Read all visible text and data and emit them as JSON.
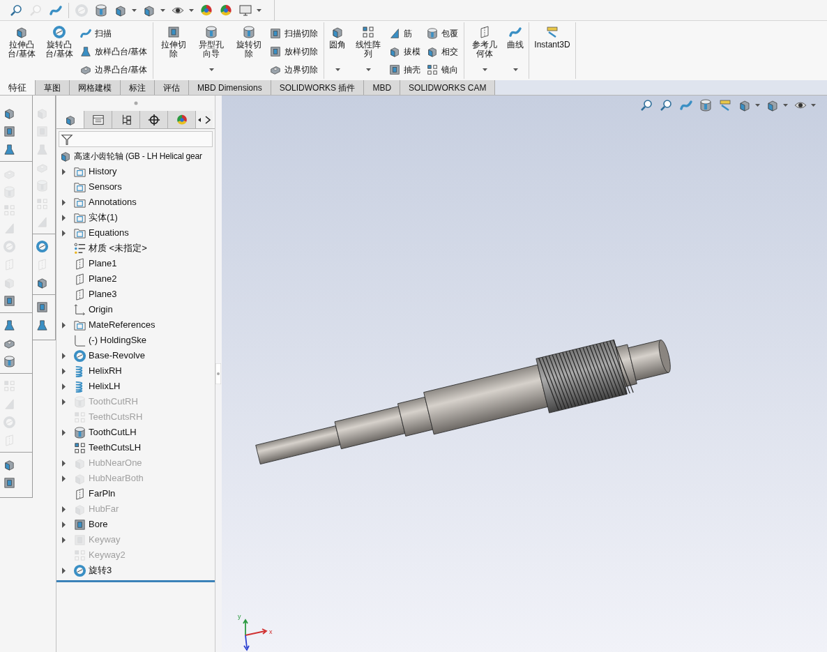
{
  "top_toolbar": [
    {
      "disabled": false,
      "dropdown": false
    },
    {
      "disabled": true,
      "dropdown": false
    },
    {
      "disabled": false,
      "dropdown": false
    },
    {
      "disabled": true,
      "dropdown": false
    },
    {
      "disabled": false,
      "dropdown": false
    },
    {
      "disabled": false,
      "dropdown": true
    },
    {
      "disabled": false,
      "dropdown": true
    },
    {
      "disabled": false,
      "dropdown": true
    },
    {
      "disabled": false,
      "dropdown": false
    },
    {
      "disabled": false,
      "dropdown": false
    },
    {
      "disabled": false,
      "dropdown": true
    }
  ],
  "ribbon": {
    "groups": [
      {
        "items": [
          {
            "kind": "large",
            "label": "拉伸凸台/基体",
            "dropdown": false
          },
          {
            "kind": "large",
            "label": "旋转凸台/基体",
            "dropdown": false
          },
          {
            "kind": "column",
            "labels": [
              "扫描",
              "放样凸台/基体",
              "边界凸台/基体"
            ]
          }
        ]
      },
      {
        "items": [
          {
            "kind": "large",
            "label": "拉伸切除",
            "dropdown": false
          },
          {
            "kind": "large",
            "label": "异型孔向导",
            "dropdown": true
          },
          {
            "kind": "large",
            "label": "旋转切除",
            "dropdown": false
          },
          {
            "kind": "column",
            "labels": [
              "扫描切除",
              "放样切除",
              "边界切除"
            ]
          }
        ]
      },
      {
        "items": [
          {
            "kind": "large",
            "label": "圆角",
            "dropdown": true
          },
          {
            "kind": "large",
            "label": "线性阵列",
            "dropdown": true
          },
          {
            "kind": "column",
            "labels": [
              "筋",
              "拔模",
              "抽壳"
            ]
          },
          {
            "kind": "column",
            "labels": [
              "包覆",
              "相交",
              "镜向"
            ]
          }
        ]
      },
      {
        "items": [
          {
            "kind": "large",
            "label": "参考几何体",
            "dropdown": true
          },
          {
            "kind": "large",
            "label": "曲线",
            "dropdown": true
          }
        ]
      },
      {
        "items": [
          {
            "kind": "large",
            "label": "Instant3D",
            "dropdown": false
          }
        ]
      }
    ]
  },
  "tabs": [
    {
      "label": "特征",
      "selected": true
    },
    {
      "label": "草图",
      "selected": false
    },
    {
      "label": "网格建模",
      "selected": false
    },
    {
      "label": "标注",
      "selected": false
    },
    {
      "label": "评估",
      "selected": false
    },
    {
      "label": "MBD Dimensions",
      "selected": false
    },
    {
      "label": "SOLIDWORKS 插件",
      "selected": false
    },
    {
      "label": "MBD",
      "selected": false
    },
    {
      "label": "SOLIDWORKS CAM",
      "selected": false
    }
  ],
  "left_toolbar_1": [
    {
      "kind": "tool",
      "disabled": false
    },
    {
      "kind": "tool",
      "disabled": false
    },
    {
      "kind": "tool",
      "disabled": false
    },
    {
      "kind": "separator"
    },
    {
      "kind": "tool",
      "disabled": true
    },
    {
      "kind": "tool",
      "disabled": true
    },
    {
      "kind": "tool",
      "disabled": true
    },
    {
      "kind": "tool",
      "disabled": true
    },
    {
      "kind": "tool",
      "disabled": true
    },
    {
      "kind": "tool",
      "disabled": true
    },
    {
      "kind": "tool",
      "disabled": true
    },
    {
      "kind": "tool",
      "disabled": false
    },
    {
      "kind": "separator"
    },
    {
      "kind": "tool",
      "disabled": false
    },
    {
      "kind": "tool",
      "disabled": false
    },
    {
      "kind": "tool",
      "disabled": false
    },
    {
      "kind": "separator"
    },
    {
      "kind": "tool",
      "disabled": true
    },
    {
      "kind": "tool",
      "disabled": true
    },
    {
      "kind": "tool",
      "disabled": true
    },
    {
      "kind": "tool",
      "disabled": true
    },
    {
      "kind": "separator"
    },
    {
      "kind": "tool",
      "disabled": false
    },
    {
      "kind": "tool",
      "disabled": false
    }
  ],
  "left_toolbar_2": [
    {
      "kind": "tool",
      "disabled": true
    },
    {
      "kind": "tool",
      "disabled": true
    },
    {
      "kind": "tool",
      "disabled": true
    },
    {
      "kind": "tool",
      "disabled": true
    },
    {
      "kind": "tool",
      "disabled": true
    },
    {
      "kind": "tool",
      "disabled": true
    },
    {
      "kind": "tool",
      "disabled": true
    },
    {
      "kind": "separator"
    },
    {
      "kind": "tool",
      "disabled": false
    },
    {
      "kind": "tool",
      "disabled": true
    },
    {
      "kind": "tool",
      "disabled": false
    },
    {
      "kind": "separator"
    },
    {
      "kind": "tool",
      "disabled": false
    },
    {
      "kind": "tool",
      "disabled": false
    }
  ],
  "panel_tabs": [
    {
      "selected": true
    },
    {
      "selected": false
    },
    {
      "selected": false
    },
    {
      "selected": false
    },
    {
      "selected": false
    }
  ],
  "tree": {
    "root": "高速小齿轮轴 (GB - LH Helical gear",
    "items": [
      {
        "kind": "folder",
        "label": "History",
        "expandable": true,
        "suppressed": false
      },
      {
        "kind": "folder",
        "label": "Sensors",
        "expandable": false,
        "suppressed": false
      },
      {
        "kind": "folder",
        "label": "Annotations",
        "expandable": true,
        "suppressed": false
      },
      {
        "kind": "folder",
        "label": "实体(1)",
        "expandable": true,
        "suppressed": false
      },
      {
        "kind": "folder",
        "label": "Equations",
        "expandable": true,
        "suppressed": false
      },
      {
        "kind": "material",
        "label": "材质 <未指定>",
        "expandable": false,
        "suppressed": false
      },
      {
        "kind": "plane",
        "label": "Plane1",
        "expandable": false,
        "suppressed": false
      },
      {
        "kind": "plane",
        "label": "Plane2",
        "expandable": false,
        "suppressed": false
      },
      {
        "kind": "plane",
        "label": "Plane3",
        "expandable": false,
        "suppressed": false
      },
      {
        "kind": "origin",
        "label": "Origin",
        "expandable": false,
        "suppressed": false
      },
      {
        "kind": "folder",
        "label": "MateReferences",
        "expandable": true,
        "suppressed": false
      },
      {
        "kind": "sketch",
        "label": "(-) HoldingSke",
        "expandable": false,
        "suppressed": false
      },
      {
        "kind": "revolve",
        "label": "Base-Revolve",
        "expandable": true,
        "suppressed": false
      },
      {
        "kind": "helix",
        "label": "HelixRH",
        "expandable": true,
        "suppressed": false
      },
      {
        "kind": "helix",
        "label": "HelixLH",
        "expandable": true,
        "suppressed": false
      },
      {
        "kind": "cut",
        "label": "ToothCutRH",
        "expandable": true,
        "suppressed": true
      },
      {
        "kind": "pattern",
        "label": "TeethCutsRH",
        "expandable": false,
        "suppressed": true
      },
      {
        "kind": "cut",
        "label": "ToothCutLH",
        "expandable": true,
        "suppressed": false
      },
      {
        "kind": "pattern",
        "label": "TeethCutsLH",
        "expandable": false,
        "suppressed": false
      },
      {
        "kind": "boss",
        "label": "HubNearOne",
        "expandable": true,
        "suppressed": true
      },
      {
        "kind": "boss",
        "label": "HubNearBoth",
        "expandable": true,
        "suppressed": true
      },
      {
        "kind": "plane",
        "label": "FarPln",
        "expandable": false,
        "suppressed": false
      },
      {
        "kind": "boss",
        "label": "HubFar",
        "expandable": true,
        "suppressed": true
      },
      {
        "kind": "extrude_cut",
        "label": "Bore",
        "expandable": true,
        "suppressed": false
      },
      {
        "kind": "extrude_cut",
        "label": "Keyway",
        "expandable": true,
        "suppressed": true
      },
      {
        "kind": "pattern",
        "label": "Keyway2",
        "expandable": false,
        "suppressed": true
      },
      {
        "kind": "revolve",
        "label": "旋转3",
        "expandable": true,
        "suppressed": false
      }
    ]
  },
  "view_toolbar": [
    {
      "dropdown": false
    },
    {
      "dropdown": false
    },
    {
      "dropdown": false
    },
    {
      "dropdown": false
    },
    {
      "dropdown": false
    },
    {
      "dropdown": true
    },
    {
      "dropdown": true
    },
    {
      "dropdown": true
    }
  ],
  "triad": {
    "x_label": "x",
    "y_label": "y"
  }
}
